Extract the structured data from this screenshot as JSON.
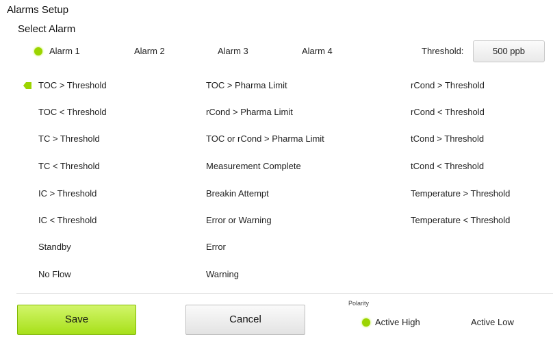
{
  "header": {
    "title": "Alarms Setup",
    "subtitle": "Select Alarm"
  },
  "alarm_tabs": [
    {
      "label": "Alarm 1",
      "selected": true
    },
    {
      "label": "Alarm 2",
      "selected": false
    },
    {
      "label": "Alarm 3",
      "selected": false
    },
    {
      "label": "Alarm 4",
      "selected": false
    }
  ],
  "threshold": {
    "label": "Threshold:",
    "value": "500 ppb"
  },
  "conditions": {
    "col1": [
      "TOC > Threshold",
      "TOC < Threshold",
      "TC > Threshold",
      "TC < Threshold",
      "IC > Threshold",
      "IC < Threshold",
      "Standby",
      "No Flow"
    ],
    "col2": [
      "TOC > Pharma Limit",
      "rCond > Pharma Limit",
      "TOC or rCond > Pharma Limit",
      "Measurement Complete",
      "Breakin Attempt",
      "Error or Warning",
      "Error",
      "Warning"
    ],
    "col3": [
      "rCond > Threshold",
      "rCond < Threshold",
      "tCond > Threshold",
      "tCond < Threshold",
      "Temperature > Threshold",
      "Temperature < Threshold"
    ],
    "selected": "TOC > Threshold"
  },
  "buttons": {
    "save": "Save",
    "cancel": "Cancel"
  },
  "polarity": {
    "label": "Polarity",
    "options": [
      {
        "label": "Active High",
        "selected": true
      },
      {
        "label": "Active Low",
        "selected": false
      }
    ]
  },
  "colors": {
    "accent_green": "#9bd400",
    "save_green": "#b8e835"
  }
}
